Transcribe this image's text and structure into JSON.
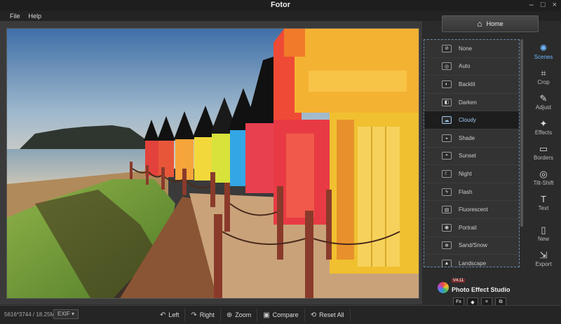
{
  "app": {
    "title": "Fotor"
  },
  "window_controls": {
    "minimize": "–",
    "maximize": "□",
    "close": "×"
  },
  "menu": {
    "items": [
      "File",
      "Help"
    ]
  },
  "home": {
    "label": "Home",
    "icon": "home-icon"
  },
  "scenes": {
    "items": [
      {
        "label": "None",
        "icon": "⊘"
      },
      {
        "label": "Auto",
        "icon": "◎"
      },
      {
        "label": "Backlit",
        "icon": "◐"
      },
      {
        "label": "Darken",
        "icon": "◧"
      },
      {
        "label": "Cloudy",
        "icon": "☁",
        "selected": true
      },
      {
        "label": "Shade",
        "icon": "◒"
      },
      {
        "label": "Sunset",
        "icon": "◓"
      },
      {
        "label": "Night",
        "icon": "☾"
      },
      {
        "label": "Flash",
        "icon": "ϟ"
      },
      {
        "label": "Fluorescent",
        "icon": "▤"
      },
      {
        "label": "Portrait",
        "icon": "◉"
      },
      {
        "label": "Sand/Snow",
        "icon": "❄"
      },
      {
        "label": "Landscape",
        "icon": "▲"
      }
    ]
  },
  "tools": [
    {
      "label": "Scenes",
      "icon": "✺",
      "active": true
    },
    {
      "label": "Crop",
      "icon": "⌗"
    },
    {
      "label": "Adjust",
      "icon": "✎"
    },
    {
      "label": "Effects",
      "icon": "✦"
    },
    {
      "label": "Borders",
      "icon": "▭"
    },
    {
      "label": "Tilt-Shift",
      "icon": "◎"
    },
    {
      "label": "Text",
      "icon": "T"
    },
    {
      "label": "New",
      "icon": "▯"
    },
    {
      "label": "Export",
      "icon": "⇲"
    }
  ],
  "bottom": {
    "image_info": "5616*3744 / 18.25MB",
    "exif_label": "EXIF ▾",
    "tools": [
      {
        "label": "Left",
        "icon": "↶"
      },
      {
        "label": "Right",
        "icon": "↷"
      },
      {
        "label": "Zoom",
        "icon": "⊕"
      },
      {
        "label": "Compare",
        "icon": "▣"
      },
      {
        "label": "Reset All",
        "icon": "⟲"
      }
    ]
  },
  "promo": {
    "version": "V4.11",
    "title": "Photo Effect Studio",
    "icons": [
      "Fx",
      "◆",
      "⌗",
      "⧉"
    ]
  }
}
